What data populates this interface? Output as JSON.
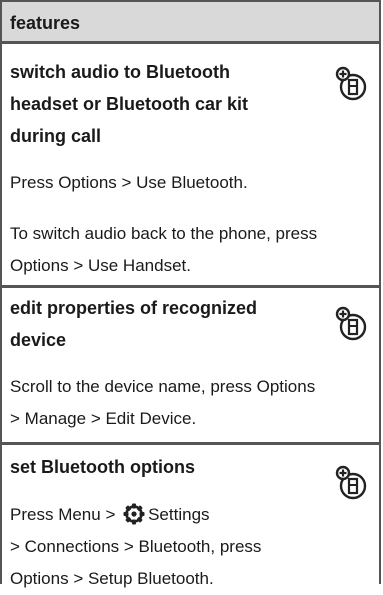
{
  "table": {
    "title": "features"
  },
  "sections": [
    {
      "heading_lines": [
        "switch audio to Bluetooth",
        "headset or Bluetooth car kit",
        "during call"
      ],
      "icon": "bluetooth-feature-icon",
      "paragraphs": [
        {
          "line1": [
            "Press ",
            "Options",
            " > ",
            "Use Bluetooth",
            "."
          ]
        },
        {
          "line1": [
            "To switch audio back to the phone, press"
          ],
          "line2": [
            "Options",
            " > ",
            "Use Handset",
            "."
          ]
        }
      ]
    },
    {
      "heading_lines": [
        "edit properties of recognized",
        "device"
      ],
      "icon": "bluetooth-feature-icon",
      "paragraphs": [
        {
          "line1": [
            "Scroll to the device name, press ",
            "Options"
          ],
          "line2": [
            "> ",
            "Manage",
            " > ",
            "Edit Device",
            "."
          ]
        }
      ]
    },
    {
      "heading_lines": [
        "set Bluetooth options"
      ],
      "icon": "bluetooth-feature-icon",
      "paragraphs": [
        {
          "line1": [
            "Press ",
            "Menu",
            " > ",
            "Settings"
          ],
          "line2": [
            "> ",
            "Connections",
            " > ",
            "Bluetooth",
            ", press"
          ],
          "line3": [
            "Options",
            " > ",
            "Setup Bluetooth",
            "."
          ]
        }
      ]
    }
  ],
  "settings_icon": "settings-gear-icon",
  "colors": {
    "header_bg": "#d9d9d9",
    "rule": "#555555"
  }
}
